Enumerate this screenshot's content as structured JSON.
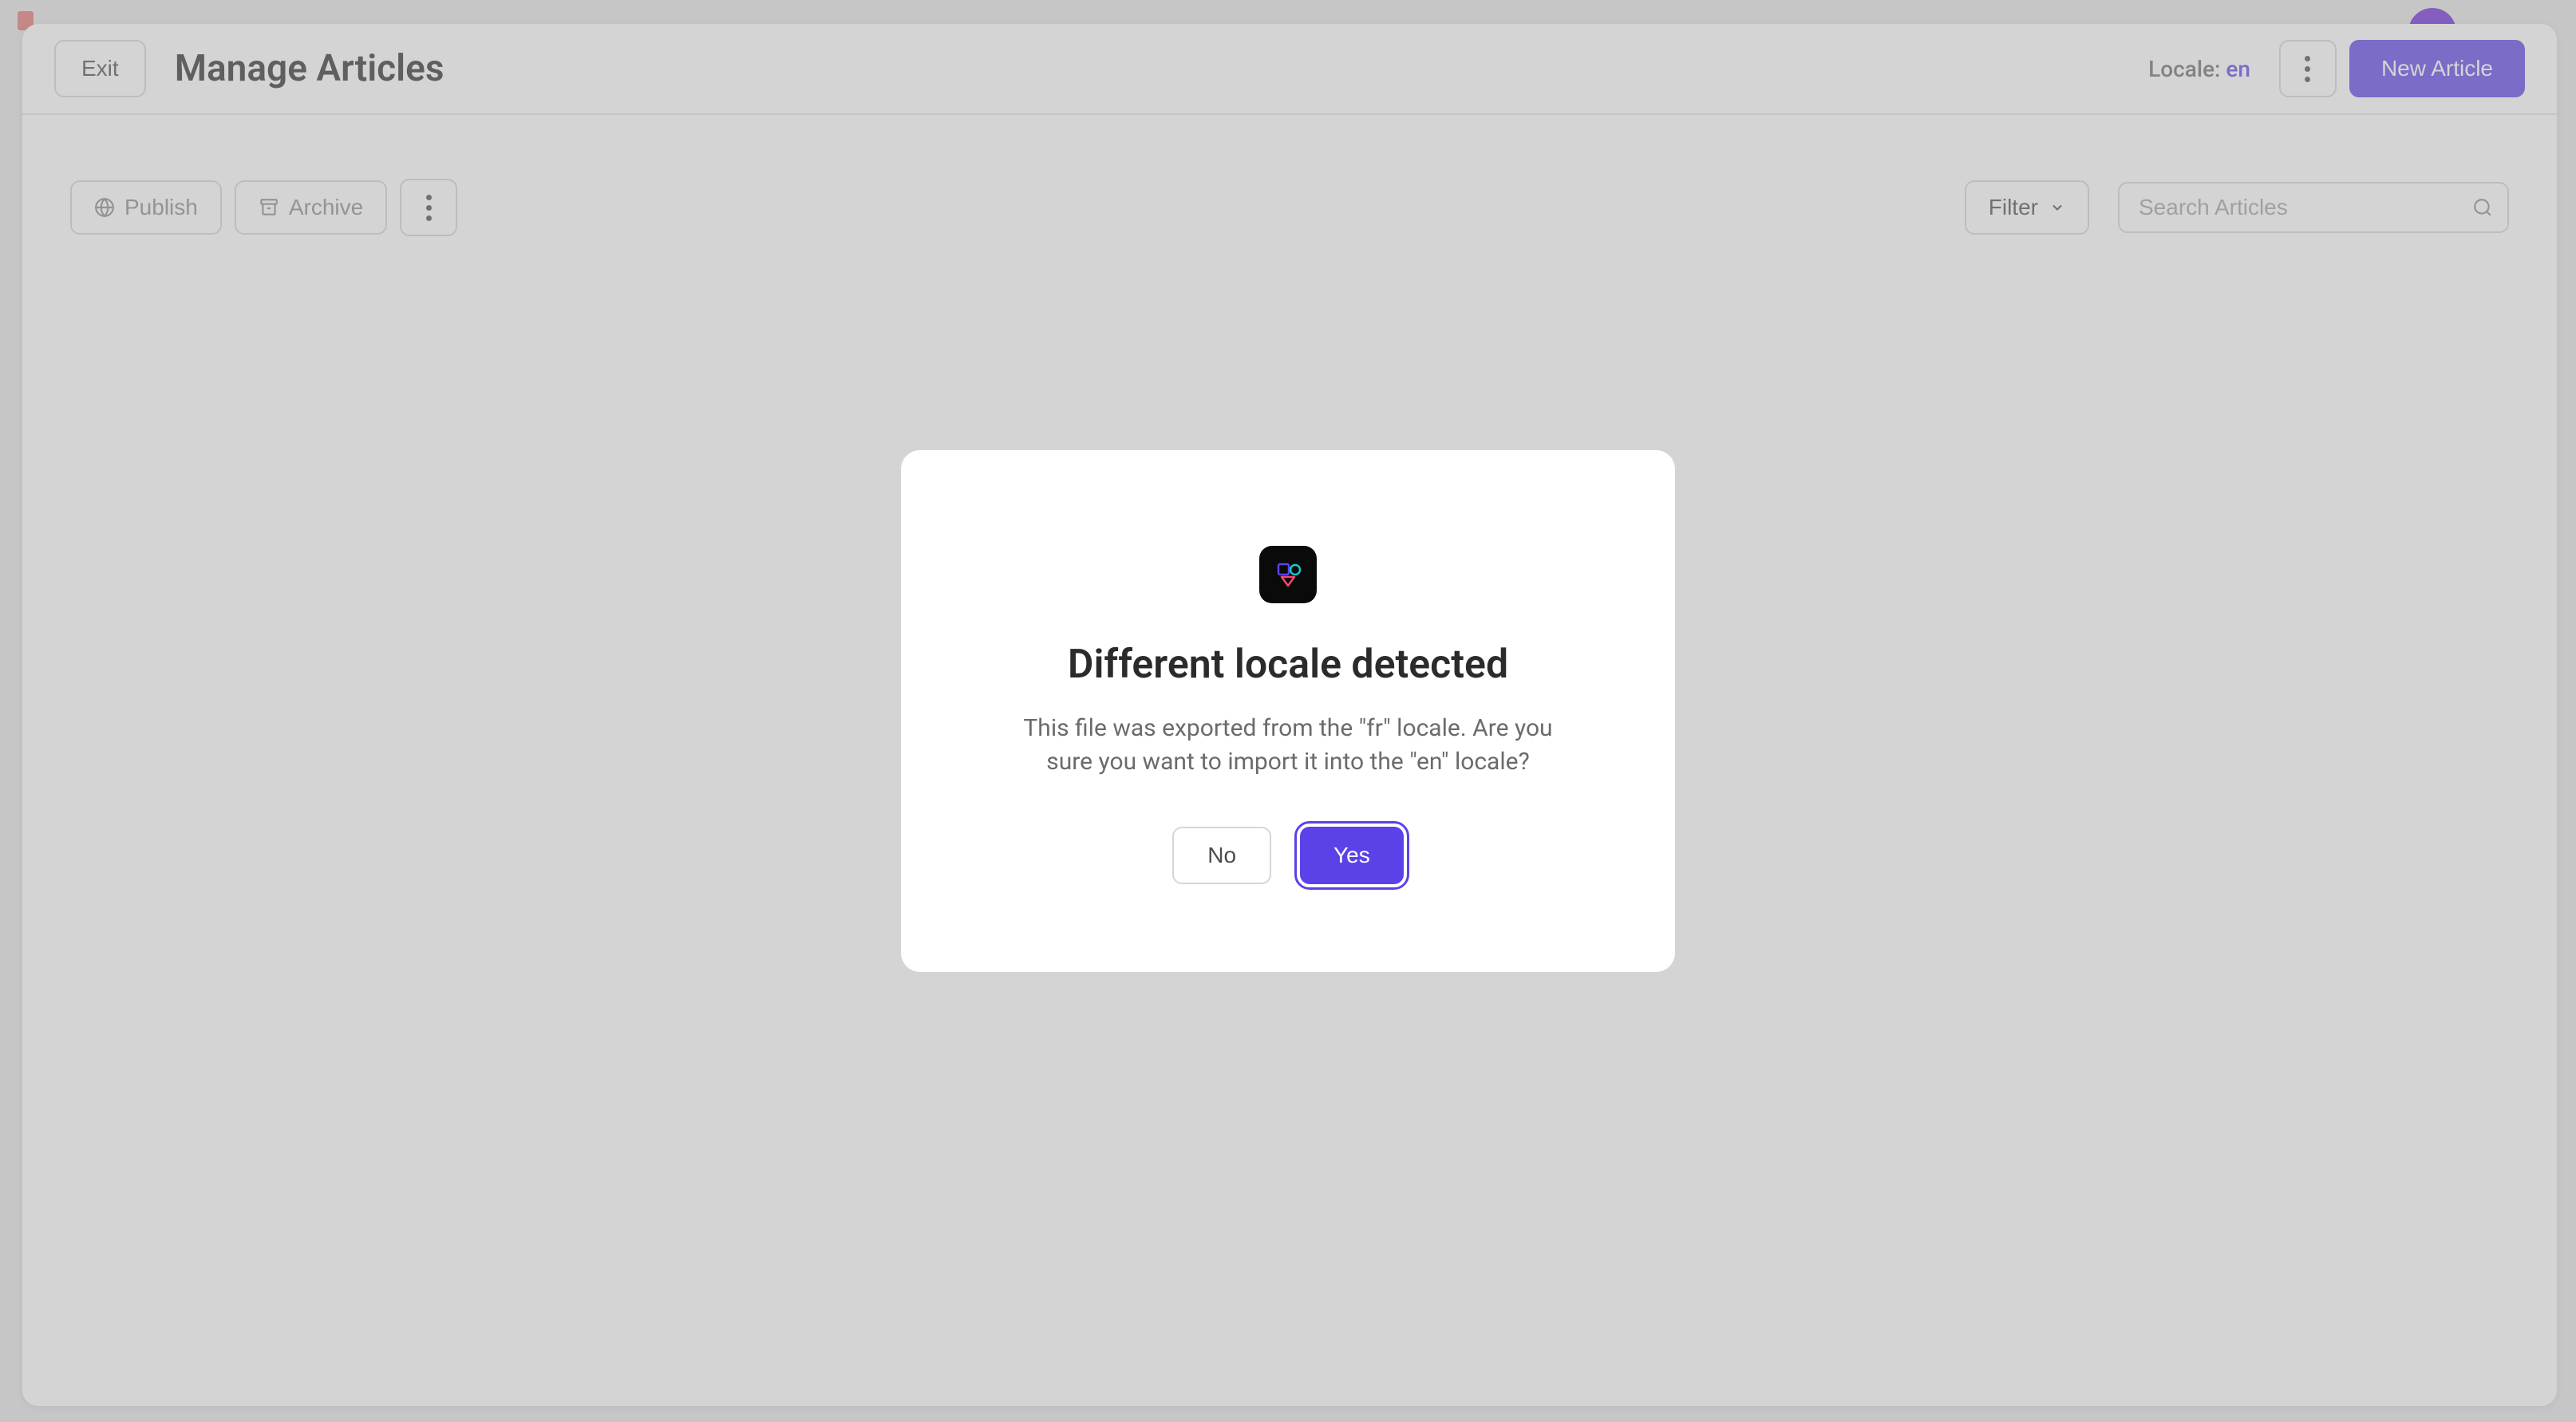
{
  "header": {
    "exit_label": "Exit",
    "title": "Manage Articles",
    "locale_label": "Locale: ",
    "locale_value": "en",
    "new_article_label": "New Article"
  },
  "toolbar": {
    "publish_label": "Publish",
    "archive_label": "Archive",
    "filter_label": "Filter",
    "search_placeholder": "Search Articles"
  },
  "modal": {
    "title": "Different locale detected",
    "body": "This file was exported from the \"fr\" locale. Are you sure you want to import it into the \"en\" locale?",
    "no_label": "No",
    "yes_label": "Yes"
  },
  "colors": {
    "accent": "#5b42e8"
  }
}
